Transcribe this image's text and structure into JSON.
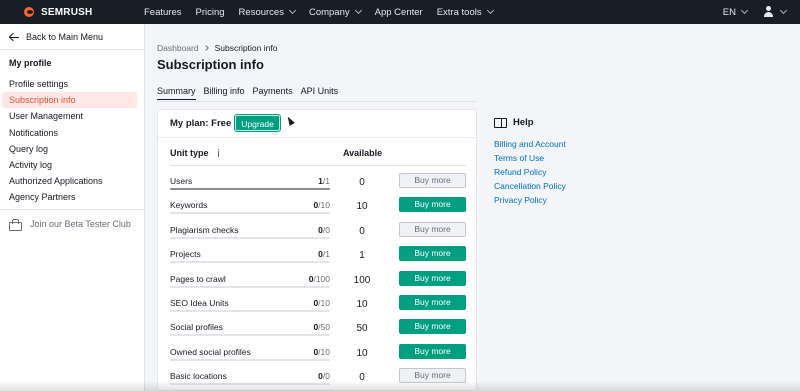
{
  "topnav": {
    "brand": "SEMRUSH",
    "items": [
      {
        "label": "Features",
        "caret": false
      },
      {
        "label": "Pricing",
        "caret": false
      },
      {
        "label": "Resources",
        "caret": true
      },
      {
        "label": "Company",
        "caret": true
      },
      {
        "label": "App Center",
        "caret": false
      },
      {
        "label": "Extra tools",
        "caret": true
      }
    ],
    "language": "EN"
  },
  "sidebar": {
    "back_label": "Back to Main Menu",
    "section_title": "My profile",
    "items": [
      {
        "label": "Profile settings",
        "active": false
      },
      {
        "label": "Subscription info",
        "active": true
      },
      {
        "label": "User Management",
        "active": false
      },
      {
        "label": "Notifications",
        "active": false
      },
      {
        "label": "Query log",
        "active": false
      },
      {
        "label": "Activity log",
        "active": false
      },
      {
        "label": "Authorized Applications",
        "active": false
      },
      {
        "label": "Agency Partners",
        "active": false
      }
    ],
    "beta_label": "Join our Beta Tester Club"
  },
  "main": {
    "breadcrumb": {
      "root": "Dashboard",
      "current": "Subscription info"
    },
    "title": "Subscription info",
    "tabs": [
      {
        "label": "Summary",
        "active": true
      },
      {
        "label": "Billing info",
        "active": false
      },
      {
        "label": "Payments",
        "active": false
      },
      {
        "label": "API Units",
        "active": false
      }
    ],
    "plan": {
      "label": "My plan: Free",
      "upgrade_label": "Upgrade"
    },
    "table": {
      "col_unit": "Unit type",
      "col_available": "Available",
      "rows": [
        {
          "name": "Users",
          "used": "1",
          "total": "/1",
          "progress": 1.0,
          "available": "0",
          "button": "Buy more",
          "enabled": false
        },
        {
          "name": "Keywords",
          "used": "0",
          "total": "/10",
          "progress": 0,
          "available": "10",
          "button": "Buy more",
          "enabled": true
        },
        {
          "name": "Plagiarism checks",
          "used": "0",
          "total": "/0",
          "progress": 0,
          "available": "0",
          "button": "Buy more",
          "enabled": false
        },
        {
          "name": "Projects",
          "used": "0",
          "total": "/1",
          "progress": 0,
          "available": "1",
          "button": "Buy more",
          "enabled": true
        },
        {
          "name": "Pages to crawl",
          "used": "0",
          "total": "/100",
          "progress": 0,
          "available": "100",
          "button": "Buy more",
          "enabled": true
        },
        {
          "name": "SEO Idea Units",
          "used": "0",
          "total": "/10",
          "progress": 0,
          "available": "10",
          "button": "Buy more",
          "enabled": true
        },
        {
          "name": "Social profiles",
          "used": "0",
          "total": "/50",
          "progress": 0,
          "available": "50",
          "button": "Buy more",
          "enabled": true
        },
        {
          "name": "Owned social profiles",
          "used": "0",
          "total": "/10",
          "progress": 0,
          "available": "10",
          "button": "Buy more",
          "enabled": true
        },
        {
          "name": "Basic locations",
          "used": "0",
          "total": "/0",
          "progress": 0,
          "available": "0",
          "button": "Buy more",
          "enabled": false
        }
      ]
    }
  },
  "help": {
    "title": "Help",
    "links": [
      "Billing and Account",
      "Terms of Use",
      "Refund Policy",
      "Cancellation Policy",
      "Privacy Policy"
    ]
  },
  "colors": {
    "brand": "#ff642d",
    "primary": "#009f81",
    "link": "#006dca",
    "active_bg": "#fde8e6",
    "active_text": "#e8502f"
  }
}
